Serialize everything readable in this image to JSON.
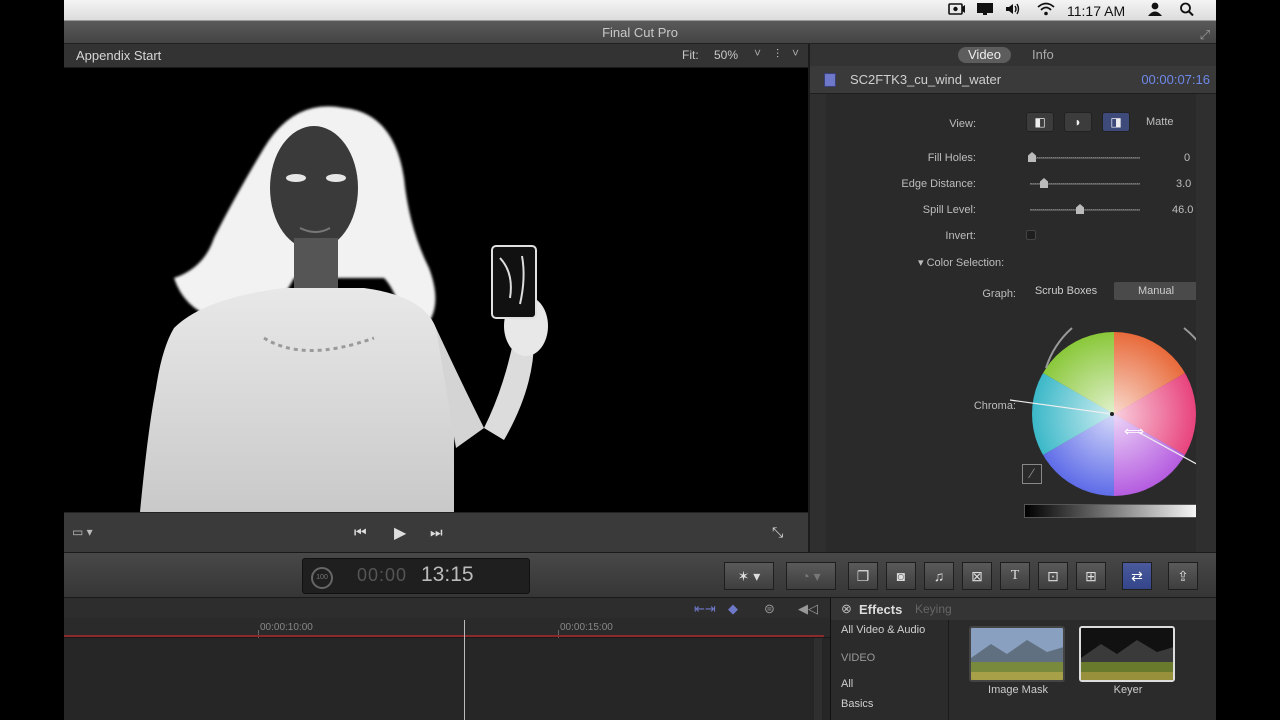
{
  "menubar": {
    "time": "11:17 AM",
    "icons": [
      "screen-record-icon",
      "display-icon",
      "volume-icon",
      "wifi-icon",
      "user-icon",
      "spotlight-search-icon"
    ]
  },
  "window": {
    "title": "Final Cut Pro"
  },
  "viewer": {
    "project_name": "Appendix Start",
    "fit_label": "Fit:",
    "zoom": "50%"
  },
  "inspector": {
    "tabs": [
      {
        "label": "Video",
        "active": true
      },
      {
        "label": "Info",
        "active": false
      }
    ],
    "clip_name": "SC2FTK3_cu_wind_water",
    "clip_timecode": "00:00:07:16",
    "view_label": "View:",
    "view_mode": "Matte",
    "params": [
      {
        "label": "Fill Holes:",
        "value": "0",
        "position": 0.0
      },
      {
        "label": "Edge Distance:",
        "value": "3.0",
        "position": 0.1
      },
      {
        "label": "Spill Level:",
        "value": "46.0",
        "unit": "%",
        "position": 0.46
      }
    ],
    "invert_label": "Invert:",
    "color_selection_label": "Color Selection:",
    "graph_label": "Graph:",
    "graph_options": [
      {
        "label": "Scrub Boxes",
        "active": false
      },
      {
        "label": "Manual",
        "active": true
      }
    ],
    "chroma_label": "Chroma:"
  },
  "dashboard": {
    "background_tasks": "100",
    "timecode_dim": "00:00",
    "timecode": "13:15"
  },
  "timeline": {
    "ruler_labels": [
      "00:00:10:00",
      "00:00:15:00"
    ]
  },
  "effects": {
    "title": "Effects",
    "subtitle": "Keying",
    "categories": [
      "All Video & Audio",
      "VIDEO",
      "All",
      "Basics"
    ],
    "items": [
      {
        "name": "Image Mask",
        "selected": false
      },
      {
        "name": "Keyer",
        "selected": true
      }
    ]
  }
}
